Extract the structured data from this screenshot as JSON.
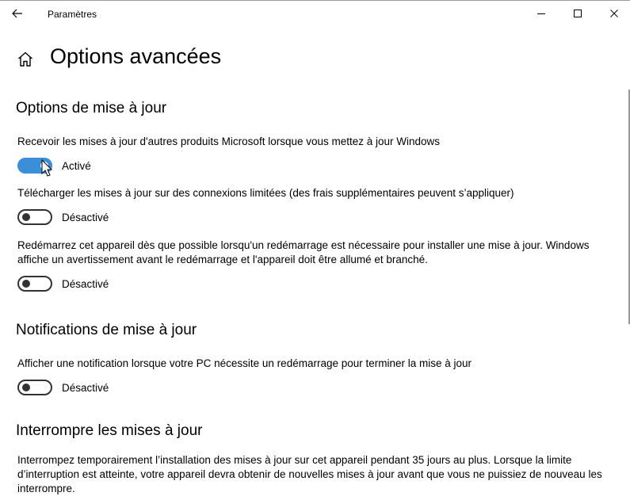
{
  "titlebar": {
    "app_title": "Paramètres"
  },
  "header": {
    "page_title": "Options avancées"
  },
  "icons": {
    "back": "back-arrow-icon",
    "home": "home-icon",
    "minimize": "minimize-icon",
    "maximize": "maximize-icon",
    "close": "close-icon"
  },
  "colors": {
    "accent": "#3b8fd9",
    "toggle_off": "#333333"
  },
  "sections": {
    "update_options": {
      "title": "Options de mise à jour",
      "items": [
        {
          "label": "Recevoir les mises à jour d'autres produits Microsoft lorsque vous mettez à jour Windows",
          "state": "Activé",
          "on": true
        },
        {
          "label": "Télécharger les mises à jour sur des connexions limitées (des frais supplémentaires peuvent s’appliquer)",
          "state": "Désactivé",
          "on": false
        },
        {
          "label": "Redémarrez cet appareil dès que possible lorsqu'un redémarrage est nécessaire pour installer une mise à jour. Windows affiche un avertissement avant le redémarrage et l'appareil doit être allumé et branché.",
          "state": "Désactivé",
          "on": false
        }
      ]
    },
    "update_notifications": {
      "title": "Notifications de mise à jour",
      "items": [
        {
          "label": "Afficher une notification lorsque votre PC nécessite un redémarrage pour terminer la mise à jour",
          "state": "Désactivé",
          "on": false
        }
      ]
    },
    "pause_updates": {
      "title": "Interrompre les mises à jour",
      "description": "Interrompez temporairement l’installation des mises à jour sur cet appareil pendant 35 jours au plus. Lorsque la limite d’interruption est atteinte, votre appareil devra obtenir de nouvelles mises à jour avant que vous ne puissiez de nouveau les interrompre."
    }
  }
}
